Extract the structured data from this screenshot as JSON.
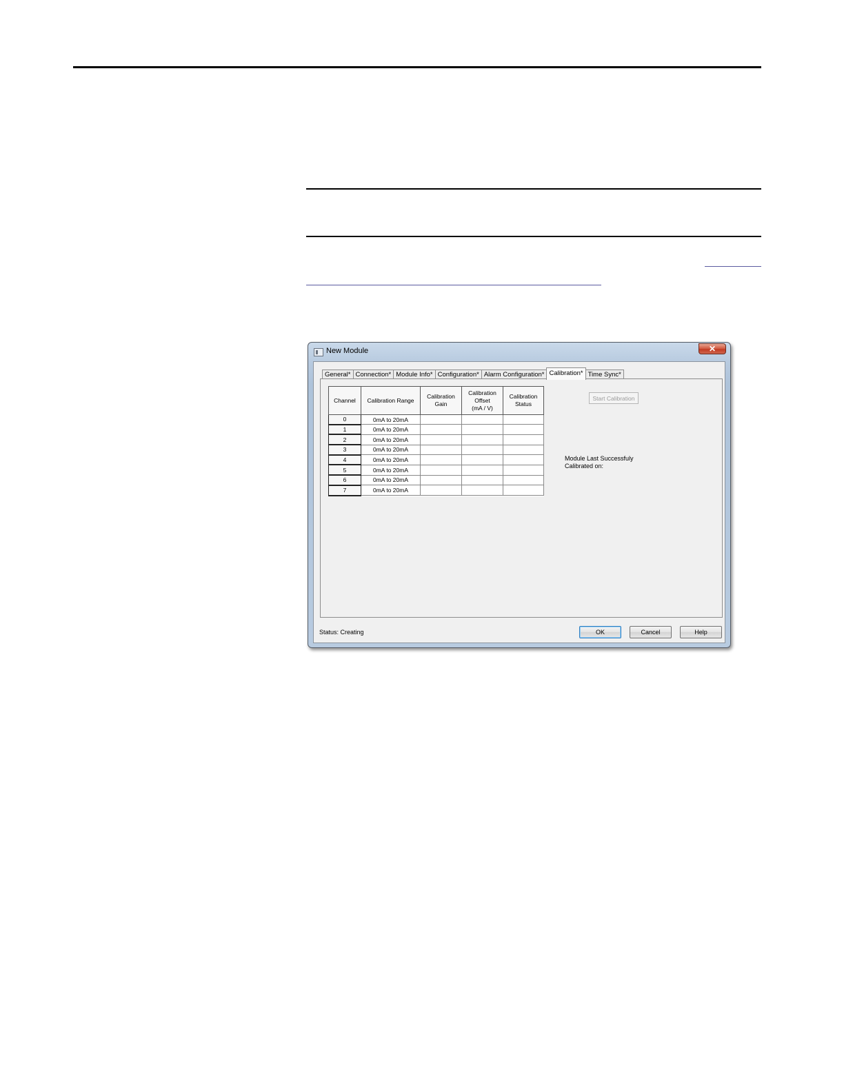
{
  "window": {
    "title": "New Module",
    "close_glyph": "✕"
  },
  "tabs": [
    {
      "label": "General*"
    },
    {
      "label": "Connection*"
    },
    {
      "label": "Module Info*"
    },
    {
      "label": "Configuration*"
    },
    {
      "label": "Alarm Configuration*"
    },
    {
      "label": "Calibration*",
      "active": true
    },
    {
      "label": "Time Sync*"
    }
  ],
  "calibration_table": {
    "headers": {
      "channel": "Channel",
      "range": "Calibration Range",
      "gain_line1": "Calibration",
      "gain_line2": "Gain",
      "offset_line1": "Calibration",
      "offset_line2": "Offset",
      "offset_line3": "(mA / V)",
      "status_line1": "Calibration",
      "status_line2": "Status"
    },
    "rows": [
      {
        "channel": "0",
        "range": "0mA to 20mA",
        "gain": "",
        "offset": "",
        "status": ""
      },
      {
        "channel": "1",
        "range": "0mA to 20mA",
        "gain": "",
        "offset": "",
        "status": ""
      },
      {
        "channel": "2",
        "range": "0mA to 20mA",
        "gain": "",
        "offset": "",
        "status": ""
      },
      {
        "channel": "3",
        "range": "0mA to 20mA",
        "gain": "",
        "offset": "",
        "status": ""
      },
      {
        "channel": "4",
        "range": "0mA to 20mA",
        "gain": "",
        "offset": "",
        "status": ""
      },
      {
        "channel": "5",
        "range": "0mA to 20mA",
        "gain": "",
        "offset": "",
        "status": ""
      },
      {
        "channel": "6",
        "range": "0mA to 20mA",
        "gain": "",
        "offset": "",
        "status": ""
      },
      {
        "channel": "7",
        "range": "0mA to 20mA",
        "gain": "",
        "offset": "",
        "status": ""
      }
    ]
  },
  "start_calibration_label": "Start Calibration",
  "last_calibrated": {
    "line1": "Module Last Successfuly",
    "line2": "Calibrated on:"
  },
  "status_text": "Status:  Creating",
  "buttons": {
    "ok": "OK",
    "cancel": "Cancel",
    "help": "Help"
  }
}
